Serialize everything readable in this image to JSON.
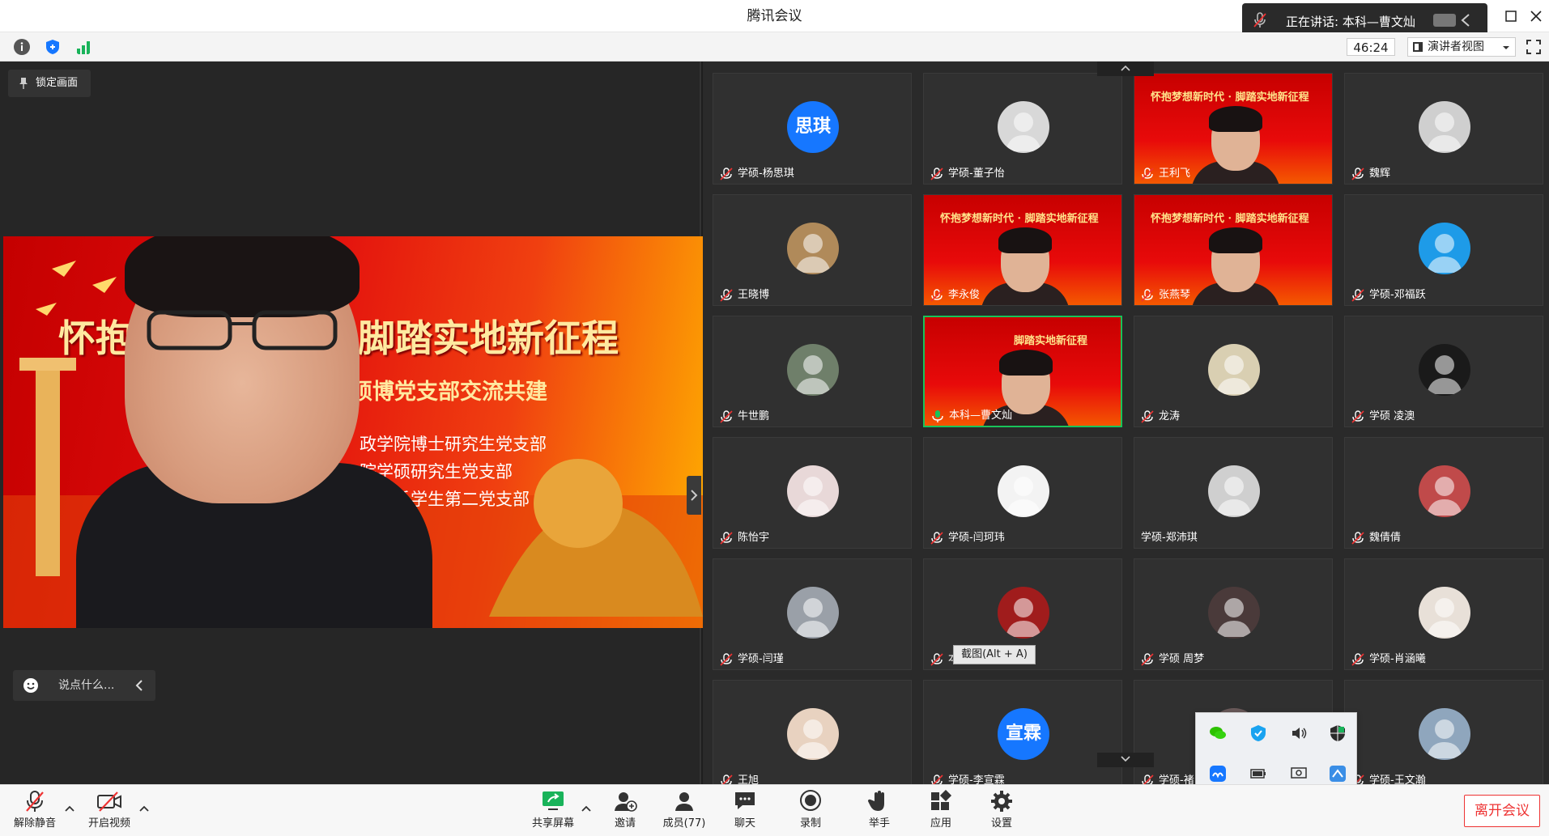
{
  "window": {
    "title": "腾讯会议"
  },
  "speaking": {
    "label": "正在讲话: 本科—曹文灿"
  },
  "toolbar": {
    "timer": "46:24",
    "view_mode": "演讲者视图"
  },
  "main": {
    "lock_label": "锁定画面",
    "chat_placeholder": "说点什么...",
    "slide_title": "怀抱梦想新时代 · 脚踏实地新征程",
    "slide_subtitle": "——题实践暨本硕博党支部交流共建",
    "slide_lines": [
      "政学院博士研究生党支部",
      "院学硕研究生党支部",
      "工程系学生第二党支部"
    ]
  },
  "slide_text": "怀抱梦想新时代 · 脚踏实地新征程",
  "active_slide_text": "脚踏实地新征程",
  "participants": [
    {
      "name": "学硕-杨思琪",
      "avatar_text": "思琪",
      "avatar_color": "#1677ff",
      "muted": true
    },
    {
      "name": "学硕-董子怡",
      "avatar_color": "#d8d8d8",
      "muted": true
    },
    {
      "name": "王利飞",
      "video": true,
      "muted": true
    },
    {
      "name": "魏辉",
      "avatar_color": "#cfcfcf",
      "muted": true
    },
    {
      "name": "王晓博",
      "avatar_color": "#b08a5a",
      "muted": true
    },
    {
      "name": "李永俊",
      "video": true,
      "muted": true
    },
    {
      "name": "张燕琴",
      "video": true,
      "muted": true
    },
    {
      "name": "学硕-邓福跃",
      "avatar_color": "#1e9be8",
      "muted": true
    },
    {
      "name": "牛世鹏",
      "avatar_color": "#6f7f6a",
      "muted": true
    },
    {
      "name": "本科—曹文灿",
      "video": true,
      "speaking": true
    },
    {
      "name": "龙涛",
      "avatar_color": "#d9cfb2",
      "muted": true
    },
    {
      "name": "学硕 凌澳",
      "avatar_color": "#1a1a1a",
      "muted": true
    },
    {
      "name": "陈怡宇",
      "avatar_color": "#e8d8d8",
      "muted": true
    },
    {
      "name": "学硕-闫珂玮",
      "avatar_color": "#f3f3f3",
      "muted": true
    },
    {
      "name": "学硕-郑沛琪",
      "avatar_color": "#cfcfcf",
      "muted": false
    },
    {
      "name": "魏倩倩",
      "avatar_color": "#c04a4a",
      "muted": true
    },
    {
      "name": "学硕-闫瑾",
      "avatar_color": "#9aa0a8",
      "muted": true
    },
    {
      "name": "本科-…",
      "avatar_color": "#a01c1c",
      "muted": true
    },
    {
      "name": "学硕 周梦",
      "avatar_color": "#4a3a3a",
      "muted": true
    },
    {
      "name": "学硕-肖涵曦",
      "avatar_color": "#e8e0d8",
      "muted": true
    },
    {
      "name": "王旭",
      "avatar_color": "#e8d2c0",
      "muted": true
    },
    {
      "name": "学硕-李宣霖",
      "avatar_text": "宣霖",
      "avatar_color": "#1677ff",
      "muted": true
    },
    {
      "name": "学硕-褚…",
      "avatar_color": "#6a5a5a",
      "muted": true
    },
    {
      "name": "学硕-王文瀚",
      "avatar_color": "#8fa6bd",
      "muted": true
    }
  ],
  "tooltip": "截图(Alt + A)",
  "bottom": {
    "unmute": "解除静音",
    "start_video": "开启视频",
    "share": "共享屏幕",
    "invite": "邀请",
    "members": "成员(77)",
    "chat": "聊天",
    "record": "录制",
    "raise_hand": "举手",
    "apps": "应用",
    "settings": "设置",
    "leave": "离开会议"
  }
}
